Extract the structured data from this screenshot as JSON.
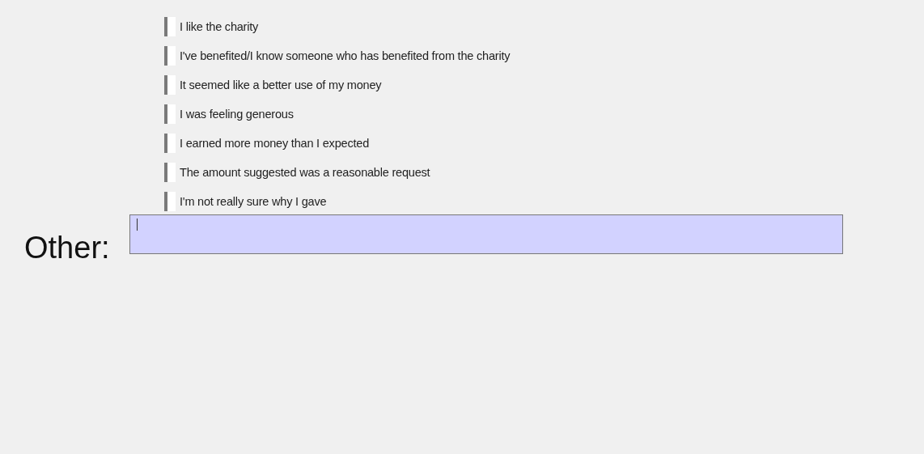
{
  "options": [
    {
      "label": "I like the charity",
      "checked": false
    },
    {
      "label": "I've benefited/I know someone who has benefited from the charity",
      "checked": false
    },
    {
      "label": "It seemed like a better use of my money",
      "checked": false
    },
    {
      "label": "I was feeling generous",
      "checked": false
    },
    {
      "label": "I earned more money than I expected",
      "checked": false
    },
    {
      "label": "The amount suggested was a reasonable request",
      "checked": false
    },
    {
      "label": "I'm not really sure why I gave",
      "checked": false
    }
  ],
  "other": {
    "label": "Other:",
    "focused": true
  }
}
